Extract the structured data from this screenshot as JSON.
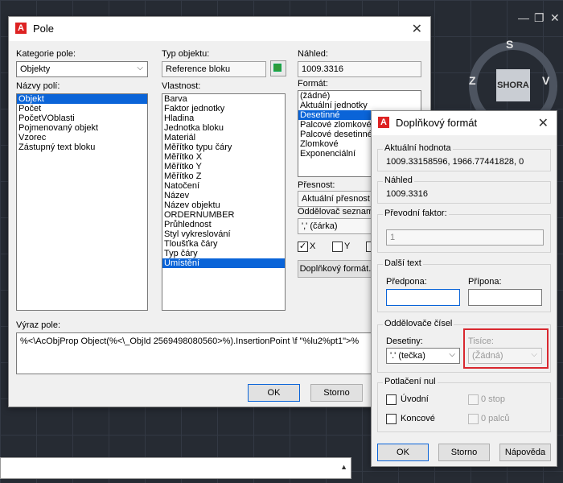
{
  "background": {
    "minimize_glyph": "—",
    "restore_glyph": "❐",
    "close_glyph": "✕",
    "viewcube": {
      "face": "SHORA",
      "north": "S",
      "west": "Z",
      "east": "V"
    }
  },
  "pole": {
    "title": "Pole",
    "kategorie_label": "Kategorie pole:",
    "kategorie_value": "Objekty",
    "nazvy_label": "Názvy polí:",
    "nazvy_items": [
      "Objekt",
      "Počet",
      "PočetVOblasti",
      "Pojmenovaný objekt",
      "Vzorec",
      "Zástupný text bloku"
    ],
    "nazvy_selected": 0,
    "typ_label": "Typ objektu:",
    "typ_value": "Reference bloku",
    "vlastnost_label": "Vlastnost:",
    "vlastnost_items": [
      "Barva",
      "Faktor jednotky",
      "Hladina",
      "Jednotka bloku",
      "Materiál",
      "Měřítko typu čáry",
      "Měřítko X",
      "Měřítko Y",
      "Měřítko Z",
      "Natočení",
      "Název",
      "Název objektu",
      "ORDERNUMBER",
      "Průhlednost",
      "Styl vykreslování",
      "Tloušťka čáry",
      "Typ čáry",
      "Umístění"
    ],
    "vlastnost_selected": 17,
    "nahled_label": "Náhled:",
    "nahled_value": "1009.3316",
    "format_label": "Formát:",
    "format_items": [
      "(žádné)",
      "Aktuální jednotky",
      "Desetinné",
      "Palcové zlomkové",
      "Palcové desetinné",
      "Zlomkové",
      "Exponenciální"
    ],
    "format_selected": 2,
    "presnost_label": "Přesnost:",
    "presnost_value": "Aktuální přesnost",
    "oddelovac_label": "Oddělovač seznamu:",
    "oddelovac_value": "',' (čárka)",
    "x_label": "X",
    "y_label": "Y",
    "x_checked": "✓",
    "doplnkovy_button": "Doplňkový formát...",
    "vyraz_label": "Výraz pole:",
    "vyraz_value": "%<\\AcObjProp Object(%<\\_ObjId 2569498080560>%).InsertionPoint \\f \"%lu2%pt1\">%",
    "ok": "OK",
    "storno": "Storno"
  },
  "doplnkovy": {
    "title": "Doplňkový formát",
    "aktualni_label": "Aktuální hodnota",
    "aktualni_value": "1009.33158596, 1966.77441828, 0",
    "nahled_label": "Náhled",
    "nahled_value": "1009.3316",
    "prevodni_label": "Převodní faktor:",
    "prevodni_value": "1",
    "dalsi_text_label": "Další text",
    "predpona_label": "Předpona:",
    "predpona_value": "",
    "pripona_label": "Přípona:",
    "pripona_value": "",
    "oddelovace_label": "Oddělovače čísel",
    "desetiny_label": "Desetiny:",
    "desetiny_value": "'.' (tečka)",
    "tisice_label": "Tisíce:",
    "tisice_value": "(Žádná)",
    "potlaceni_label": "Potlačení nul",
    "uvodni_label": "Úvodní",
    "koncove_label": "Koncové",
    "stop_label": "0 stop",
    "palcu_label": "0 palců",
    "ok": "OK",
    "storno": "Storno",
    "napoveda": "Nápověda",
    "highlight_color": "#d9282f"
  }
}
